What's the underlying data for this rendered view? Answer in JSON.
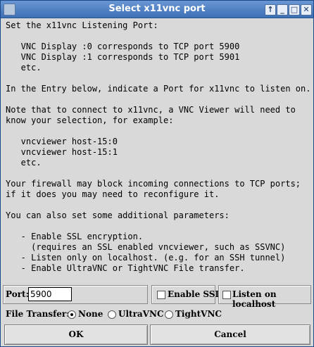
{
  "window": {
    "title": "Select x11vnc port",
    "controls": [
      "↑",
      "_",
      "□",
      "✕"
    ]
  },
  "message": {
    "text": "Set the x11vnc Listening Port:\n\n   VNC Display :0 corresponds to TCP port 5900\n   VNC Display :1 corresponds to TCP port 5901\n   etc.\n\nIn the Entry below, indicate a Port for x11vnc to listen on.\n\nNote that to connect to x11vnc, a VNC Viewer will need to\nknow your selection, for example:\n\n   vncviewer host-15:0\n   vncviewer host-15:1\n   etc.\n\nYour firewall may block incoming connections to TCP ports;\nif it does you may need to reconfigure it.\n\nYou can also set some additional parameters:\n\n   - Enable SSL encryption.\n     (requires an SSL enabled vncviewer, such as SSVNC)\n   - Listen only on localhost. (e.g. for an SSH tunnel)\n   - Enable UltraVNC or TightVNC File transfer."
  },
  "options": {
    "port_label": "Port:",
    "port_value": "5900",
    "enable_ssl_label": "Enable SSL",
    "enable_ssl_checked": false,
    "listen_localhost_label": "Listen on localhost",
    "listen_localhost_checked": false
  },
  "file_transfer": {
    "label": "File Transfer:",
    "options": [
      "None",
      "UltraVNC",
      "TightVNC"
    ],
    "selected": "None"
  },
  "buttons": {
    "ok": "OK",
    "cancel": "Cancel"
  }
}
